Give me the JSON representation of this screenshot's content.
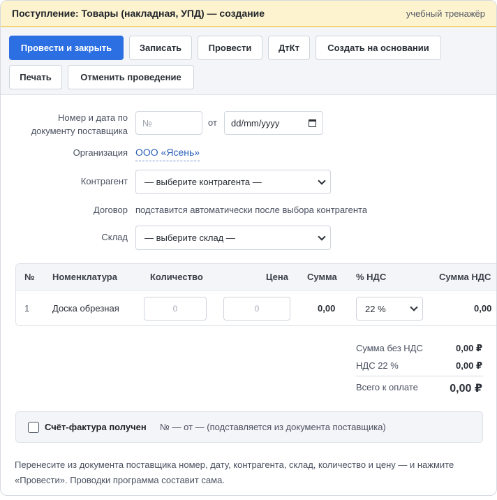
{
  "window": {
    "title": "Поступление: Товары (накладная, УПД) — создание",
    "subtitle": "учебный тренажёр"
  },
  "toolbar": {
    "post_and_close": "Провести и закрыть",
    "save": "Записать",
    "post": "Провести",
    "dtkt": "ДтКт",
    "create_based_on": "Создать на основании",
    "print": "Печать",
    "unpost": "Отменить проведение"
  },
  "form": {
    "number_label": "Номер и дата по документу поставщика",
    "number_placeholder": "№",
    "from_label": "от",
    "date_placeholder": "dd/mm/yyyy",
    "org_label": "Организация",
    "org_value": "ООО «Ясень»",
    "counterparty_label": "Контрагент",
    "counterparty_value": "— выберите контрагента —",
    "contract_label": "Договор",
    "contract_value": "подставится автоматически после выбора контрагента",
    "warehouse_label": "Склад",
    "warehouse_value": "— выберите склад —"
  },
  "table": {
    "headers": {
      "num": "№",
      "item": "Номенклатура",
      "qty": "Количество",
      "price": "Цена",
      "sum": "Сумма",
      "vat_rate": "% НДС",
      "vat_sum": "Сумма НДС"
    },
    "rows": [
      {
        "num": "1",
        "item": "Доска обрезная",
        "qty": "0",
        "price": "0",
        "sum": "0,00",
        "vat_rate": "22 %",
        "vat_sum": "0,00"
      }
    ]
  },
  "totals": {
    "without_vat_label": "Сумма без НДС",
    "without_vat_value": "0,00 ₽",
    "vat_label": "НДС 22 %",
    "vat_value": "0,00 ₽",
    "total_label": "Всего к оплате",
    "total_value": "0,00 ₽"
  },
  "invoice": {
    "label": "Счёт-фактура получен",
    "info": "№ — от — (подставляется из документа поставщика)"
  },
  "hint": "Перенесите из документа поставщика номер, дату, контрагента, склад, количество и цену — и нажмите «Провести». Проводки программа составит сама."
}
